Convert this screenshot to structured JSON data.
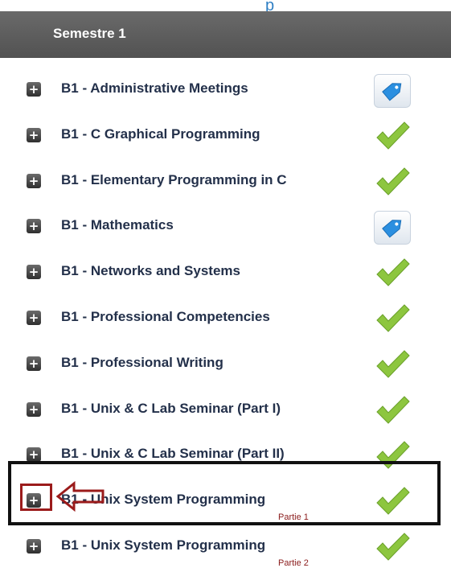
{
  "top_link": "p",
  "header": {
    "title": "Semestre 1"
  },
  "rows": [
    {
      "label": "B1 - Administrative Meetings",
      "status": "tag-icon"
    },
    {
      "label": "B1 - C Graphical Programming",
      "status": "check-icon"
    },
    {
      "label": "B1 - Elementary Programming in C",
      "status": "check-icon"
    },
    {
      "label": "B1 - Mathematics",
      "status": "tag-icon"
    },
    {
      "label": "B1 - Networks and Systems",
      "status": "check-icon"
    },
    {
      "label": "B1 - Professional Competencies",
      "status": "check-icon"
    },
    {
      "label": "B1 - Professional Writing",
      "status": "check-icon"
    },
    {
      "label": "B1 - Unix & C Lab Seminar (Part I)",
      "status": "check-icon"
    },
    {
      "label": "B1 - Unix & C Lab Seminar (Part II)",
      "status": "check-icon"
    },
    {
      "label": "B1 - Unix System Programming",
      "sub": "Partie 1",
      "status": "check-icon"
    },
    {
      "label": "B1 - Unix System Programming",
      "sub": "Partie 2",
      "status": "check-icon"
    }
  ],
  "icons": {
    "expand": "plus-icon",
    "check": "check-icon",
    "tag": "tag-icon"
  },
  "colors": {
    "header_bg": "#5a5a5a",
    "label_text": "#23304a",
    "check_green": "#8dc63f",
    "tag_blue": "#2b8fe0",
    "annotation_red": "#9b1b1b",
    "annotation_black": "#111111"
  }
}
